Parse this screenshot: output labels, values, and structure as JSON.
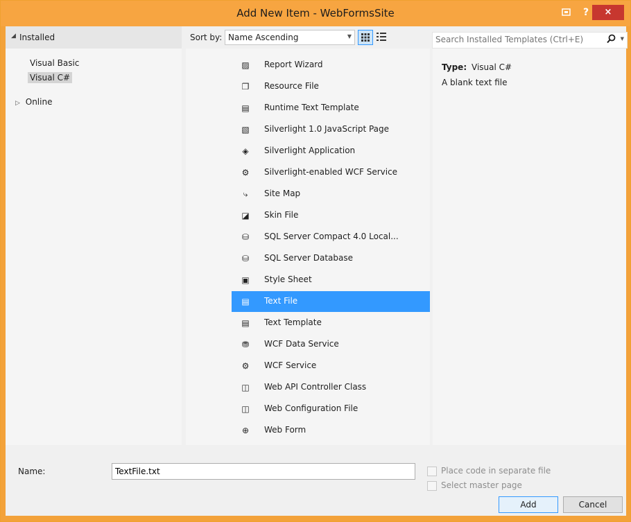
{
  "window": {
    "title": "Add New Item - WebFormsSite"
  },
  "titlebar": {
    "help_glyph": "?",
    "close_glyph": "×"
  },
  "left": {
    "header": "Installed",
    "items": [
      "Visual Basic",
      "Visual C#"
    ],
    "online": "Online"
  },
  "sort": {
    "label": "Sort by:",
    "value": "Name Ascending"
  },
  "templates": [
    {
      "name": "Report Wizard",
      "icon": "report-wizard-icon",
      "glyph": "▨"
    },
    {
      "name": "Resource File",
      "icon": "resource-file-icon",
      "glyph": "❐"
    },
    {
      "name": "Runtime Text Template",
      "icon": "runtime-text-template-icon",
      "glyph": "▤"
    },
    {
      "name": "Silverlight 1.0 JavaScript Page",
      "icon": "silverlight-js-page-icon",
      "glyph": "▧"
    },
    {
      "name": "Silverlight Application",
      "icon": "silverlight-app-icon",
      "glyph": "◈"
    },
    {
      "name": "Silverlight-enabled WCF Service",
      "icon": "wcf-service-icon",
      "glyph": "⚙"
    },
    {
      "name": "Site Map",
      "icon": "site-map-icon",
      "glyph": "⤷"
    },
    {
      "name": "Skin File",
      "icon": "skin-file-icon",
      "glyph": "◪"
    },
    {
      "name": "SQL Server Compact 4.0 Local...",
      "icon": "database-icon",
      "glyph": "⛁"
    },
    {
      "name": "SQL Server Database",
      "icon": "database-icon",
      "glyph": "⛁"
    },
    {
      "name": "Style Sheet",
      "icon": "style-sheet-icon",
      "glyph": "▣"
    },
    {
      "name": "Text File",
      "icon": "text-file-icon",
      "glyph": "▤"
    },
    {
      "name": "Text Template",
      "icon": "text-template-icon",
      "glyph": "▤"
    },
    {
      "name": "WCF Data Service",
      "icon": "wcf-data-service-icon",
      "glyph": "⛃"
    },
    {
      "name": "WCF Service",
      "icon": "wcf-service-icon",
      "glyph": "⚙"
    },
    {
      "name": "Web API Controller Class",
      "icon": "controller-class-icon",
      "glyph": "◫"
    },
    {
      "name": "Web Configuration File",
      "icon": "web-config-icon",
      "glyph": "◫"
    },
    {
      "name": "Web Form",
      "icon": "globe-icon",
      "glyph": "⊕"
    }
  ],
  "selected_template": "Text File",
  "search": {
    "placeholder": "Search Installed Templates (Ctrl+E)"
  },
  "info": {
    "type_label": "Type:",
    "type_value": "Visual C#",
    "description": "A blank text file"
  },
  "bottom": {
    "name_label": "Name:",
    "name_value": "TextFile.txt",
    "place_code": "Place code in separate file",
    "select_master": "Select master page",
    "add_label": "Add",
    "cancel_label": "Cancel"
  },
  "colors": {
    "title_bar": "#f7a541",
    "selection": "#3399ff",
    "close_button": "#c7372f"
  }
}
